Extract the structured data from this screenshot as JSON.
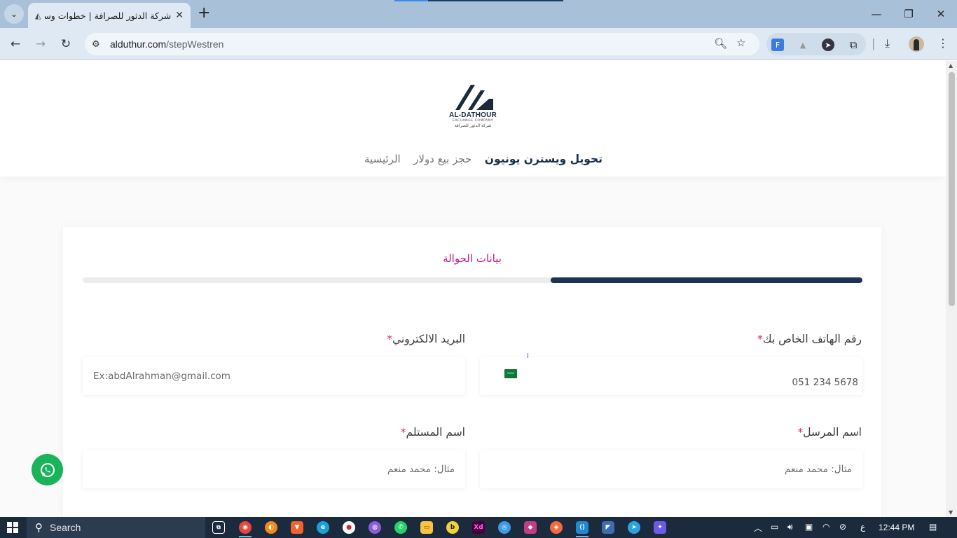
{
  "browser": {
    "tab_title": "شركة الدثور للصرافة | خطوات وسترن",
    "url_host": "alduthur.com",
    "url_path": "/stepWestren",
    "new_tab_symbol": "+"
  },
  "site": {
    "logo": {
      "brand": "AL-DATHOUR",
      "sub": "EXCHANGE COMPANY",
      "arabic": "شركة الدثور للصرافة"
    },
    "nav": [
      {
        "label": "الرئيسية",
        "active": false
      },
      {
        "label": "حجز بيع دولار",
        "active": false
      },
      {
        "label": "تحويل ويسترن يونيون",
        "active": true
      }
    ]
  },
  "form": {
    "step_title": "بيانات الحوالة",
    "progress_fraction": 0.4,
    "phone": {
      "label": "رقم الهاتف الخاص بك",
      "required_mark": "*",
      "value": "051 234 5678"
    },
    "email": {
      "label": "البريد الالكتروني",
      "required_mark": "*",
      "placeholder": "Ex:abdAlrahman@gmail.com"
    },
    "sender": {
      "label": "اسم المرسل",
      "required_mark": "*",
      "placeholder": "مثال: محمد منعم"
    },
    "receiver": {
      "label": "اسم المستلم",
      "required_mark": "*",
      "placeholder": "مثال: محمد منعم"
    }
  },
  "taskbar": {
    "search_label": "Search",
    "lang": "ع",
    "time": "12:44 PM"
  },
  "colors": {
    "accent_pink": "#c21a8b",
    "progress_dark": "#1b3452",
    "whatsapp": "#19b35a"
  }
}
